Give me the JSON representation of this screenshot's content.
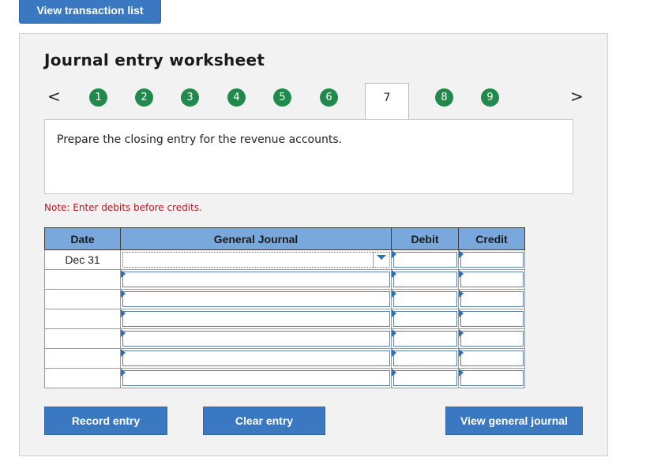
{
  "top": {
    "view_transaction_list": "View transaction list"
  },
  "worksheet": {
    "title": "Journal entry worksheet",
    "prev_arrow": "<",
    "next_arrow": ">",
    "steps": [
      "1",
      "2",
      "3",
      "4",
      "5",
      "6",
      "7",
      "8",
      "9"
    ],
    "active_step": "7",
    "instruction": "Prepare the closing entry for the revenue accounts.",
    "note": "Note: Enter debits before credits."
  },
  "table": {
    "headers": {
      "date": "Date",
      "general_journal": "General Journal",
      "debit": "Debit",
      "credit": "Credit"
    },
    "rows": [
      {
        "date": "Dec 31",
        "account": "",
        "debit": "",
        "credit": ""
      },
      {
        "date": "",
        "account": "",
        "debit": "",
        "credit": ""
      },
      {
        "date": "",
        "account": "",
        "debit": "",
        "credit": ""
      },
      {
        "date": "",
        "account": "",
        "debit": "",
        "credit": ""
      },
      {
        "date": "",
        "account": "",
        "debit": "",
        "credit": ""
      },
      {
        "date": "",
        "account": "",
        "debit": "",
        "credit": ""
      },
      {
        "date": "",
        "account": "",
        "debit": "",
        "credit": ""
      }
    ]
  },
  "buttons": {
    "record_entry": "Record entry",
    "clear_entry": "Clear entry",
    "view_general_journal": "View general journal"
  },
  "colors": {
    "button_blue": "#3a78c2",
    "step_green": "#1f8a4c",
    "header_blue": "#79a9dc",
    "note_red": "#b01c1c"
  }
}
